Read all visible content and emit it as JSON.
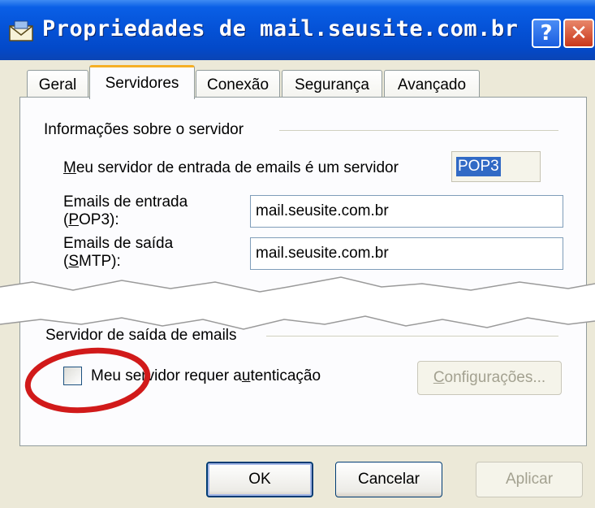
{
  "window": {
    "title": "Propriedades de mail.seusite.com.br",
    "help_button": "?",
    "close_button": "✕"
  },
  "tabs": [
    {
      "label": "Geral",
      "active": false
    },
    {
      "label": "Servidores",
      "active": true
    },
    {
      "label": "Conexão",
      "active": false
    },
    {
      "label": "Segurança",
      "active": false
    },
    {
      "label": "Avançado",
      "active": false
    }
  ],
  "server_info": {
    "group_title": "Informações sobre o servidor",
    "incoming_type_label_prefix": "M",
    "incoming_type_label_rest": "eu servidor de entrada de emails é um  servidor",
    "incoming_type_value": "POP3",
    "incoming_label_line1": "Emails de entrada",
    "incoming_label_line2_open": "(",
    "incoming_label_line2_ul": "P",
    "incoming_label_line2_rest": "OP3):",
    "incoming_value": "mail.seusite.com.br",
    "outgoing_label_line1": "Emails de saída",
    "outgoing_label_line2_open": "(",
    "outgoing_label_line2_ul": "S",
    "outgoing_label_line2_rest": "MTP):",
    "outgoing_value": "mail.seusite.com.br"
  },
  "outgoing_server": {
    "group_title": "Servidor de saída de emails",
    "auth_checkbox_label_a": "Meu servidor requer a",
    "auth_checkbox_label_ul": "u",
    "auth_checkbox_label_b": "tenticação",
    "auth_checked": false,
    "settings_button_ul": "C",
    "settings_button_rest": "onfigurações..."
  },
  "footer": {
    "ok_label": "OK",
    "cancel_label": "Cancelar",
    "apply_label": "Aplicar"
  },
  "colors": {
    "titlebar": "#0553d8",
    "dialog_bg": "#ece9d8",
    "panel_bg": "#fcfcfe",
    "selection": "#316ac5",
    "annotation_circle": "#d11a1a",
    "active_tab_accent": "#f5b025"
  },
  "icons": {
    "title": "mail-envelope-icon",
    "help": "help-icon",
    "close": "close-icon"
  }
}
